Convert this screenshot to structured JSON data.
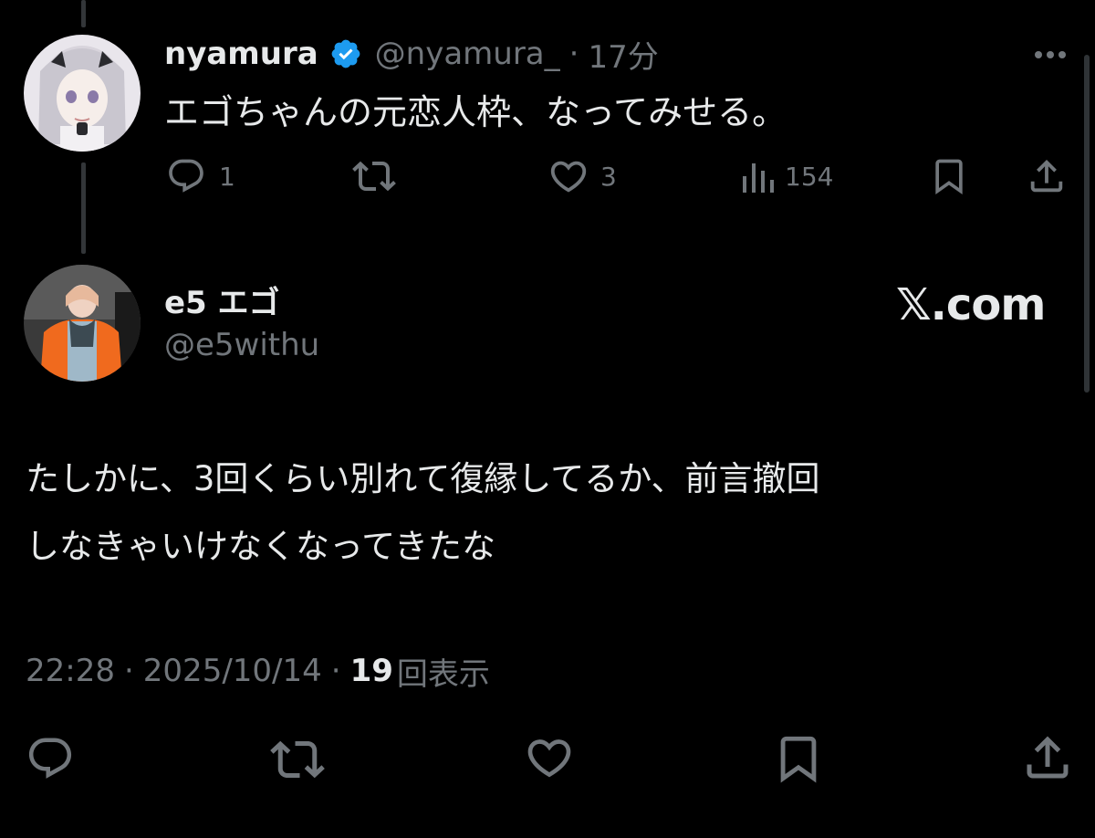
{
  "colors": {
    "background": "#000000",
    "text": "#e7e9ea",
    "muted": "#71767b",
    "verified": "#1d9bf0",
    "thread_line": "#333639"
  },
  "parent_tweet": {
    "display_name": "nyamura",
    "verified": true,
    "handle": "@nyamura_",
    "separator": "·",
    "time": "17分",
    "text": "エゴちゃんの元恋人枠、なってみせる。",
    "more_icon": "more-horizontal-icon",
    "actions": {
      "reply_count": "1",
      "retweet_count": "",
      "like_count": "3",
      "views_count": "154"
    }
  },
  "main_tweet": {
    "display_name": "e5 エゴ",
    "handle": "@e5withu",
    "source_badge": "𝕏.com",
    "text_line1": "たしかに、3回くらい別れて復縁してるか、前言撤回",
    "text_line2": "しなきゃいけなくなってきたな",
    "time": "22:28",
    "date": "2025/10/14",
    "separator": "·",
    "views_number": "19",
    "views_label": "回表示"
  }
}
